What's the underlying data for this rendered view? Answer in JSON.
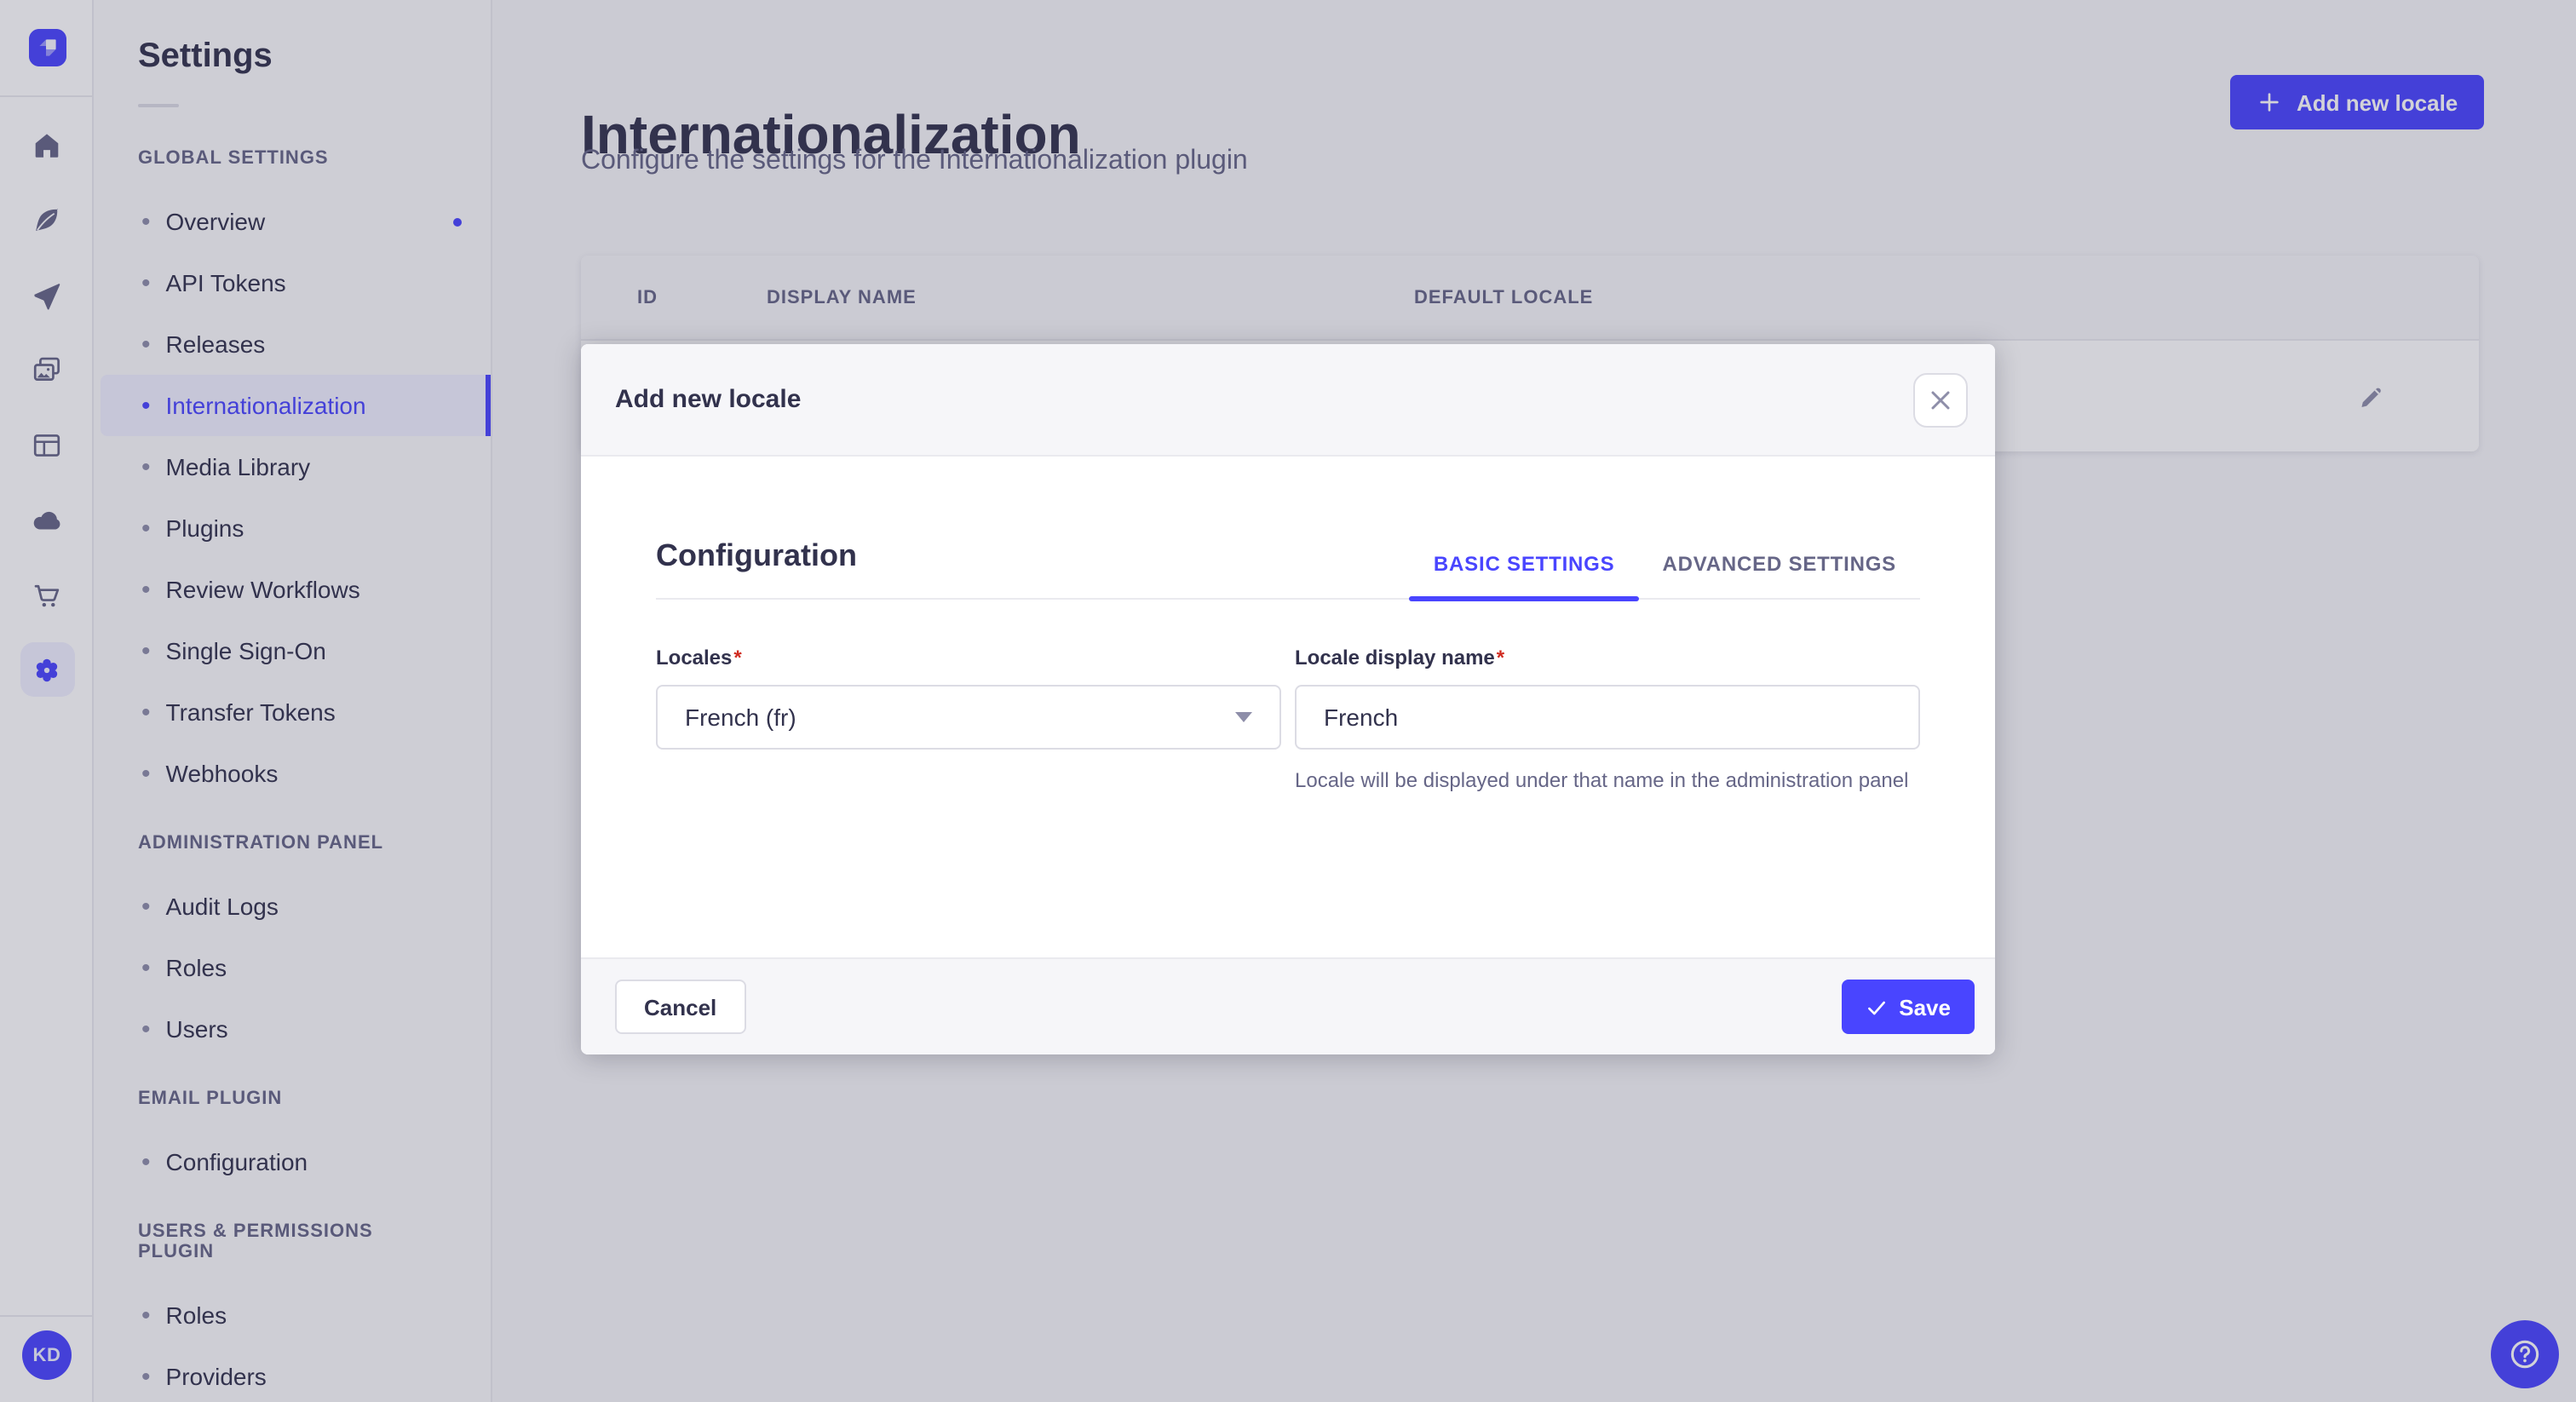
{
  "colors": {
    "accent": "#4945ff",
    "accent_light_bg": "#f0f0ff",
    "danger": "#d02b20",
    "text_primary": "#32324d",
    "text_muted": "#666687",
    "border": "#eaeaef",
    "input_border": "#dcdce4",
    "overlay": "rgba(50,50,77,0.22)"
  },
  "rail": {
    "logo_icon": "strapi-logo-icon",
    "items": [
      {
        "name": "nav-home",
        "icon": "home-icon",
        "active": false
      },
      {
        "name": "nav-content-manager",
        "icon": "feather-icon",
        "active": false
      },
      {
        "name": "nav-releases",
        "icon": "paper-plane-icon",
        "active": false
      },
      {
        "name": "nav-media-library",
        "icon": "media-library-icon",
        "active": false
      },
      {
        "name": "nav-content-type-builder",
        "icon": "layout-icon",
        "active": false
      },
      {
        "name": "nav-deploy",
        "icon": "cloud-icon",
        "active": false
      },
      {
        "name": "nav-marketplace",
        "icon": "cart-icon",
        "active": false
      },
      {
        "name": "nav-settings",
        "icon": "gear-icon",
        "active": true
      }
    ],
    "avatar_initials": "KD"
  },
  "sidebar": {
    "title": "Settings",
    "sections": [
      {
        "label": "GLOBAL SETTINGS",
        "items": [
          {
            "label": "Overview",
            "notification": true
          },
          {
            "label": "API Tokens"
          },
          {
            "label": "Releases"
          },
          {
            "label": "Internationalization",
            "active": true
          },
          {
            "label": "Media Library"
          },
          {
            "label": "Plugins"
          },
          {
            "label": "Review Workflows"
          },
          {
            "label": "Single Sign-On"
          },
          {
            "label": "Transfer Tokens"
          },
          {
            "label": "Webhooks"
          }
        ]
      },
      {
        "label": "ADMINISTRATION PANEL",
        "items": [
          {
            "label": "Audit Logs"
          },
          {
            "label": "Roles"
          },
          {
            "label": "Users"
          }
        ]
      },
      {
        "label": "EMAIL PLUGIN",
        "items": [
          {
            "label": "Configuration"
          }
        ]
      },
      {
        "label": "USERS & PERMISSIONS PLUGIN",
        "items": [
          {
            "label": "Roles"
          },
          {
            "label": "Providers"
          }
        ]
      }
    ]
  },
  "page": {
    "title": "Internationalization",
    "subtitle": "Configure the settings for the Internationalization plugin",
    "add_button_label": "Add new locale",
    "table": {
      "headers": [
        "ID",
        "DISPLAY NAME",
        "DEFAULT LOCALE"
      ],
      "row_action_icon": "edit-pencil-icon"
    }
  },
  "modal": {
    "title": "Add new locale",
    "close_icon": "close-icon",
    "section_title": "Configuration",
    "tabs": [
      {
        "label": "BASIC SETTINGS",
        "active": true
      },
      {
        "label": "ADVANCED SETTINGS",
        "active": false
      }
    ],
    "required_mark": "*",
    "fields": {
      "locales": {
        "label": "Locales",
        "required": true,
        "value": "French (fr)",
        "control": "select",
        "caret_icon": "chevron-down-icon"
      },
      "display_name": {
        "label": "Locale display name",
        "required": true,
        "value": "French",
        "hint": "Locale will be displayed under that name in the administration panel"
      }
    },
    "cancel_label": "Cancel",
    "save_label": "Save",
    "save_icon": "check-icon"
  },
  "fab": {
    "icon": "help-icon"
  }
}
